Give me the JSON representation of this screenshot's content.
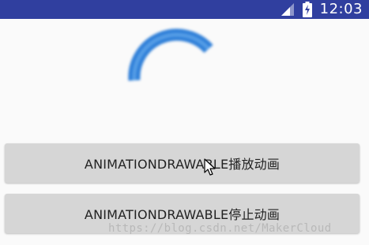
{
  "status_bar": {
    "time": "12:03",
    "signal_icon": "cellular-signal-icon",
    "battery_icon": "battery-charging-icon",
    "background_color": "#303f9f"
  },
  "animation": {
    "icon": "loading-arc-icon",
    "color": "#2f7fd8"
  },
  "buttons": {
    "play_label": "ANIMATIONDRAWABLE播放动画",
    "stop_label": "ANIMATIONDRAWABLE停止动画"
  },
  "cursor": {
    "icon": "mouse-pointer-icon"
  },
  "watermark": {
    "text": "https://blog.csdn.net/MakerCloud"
  }
}
